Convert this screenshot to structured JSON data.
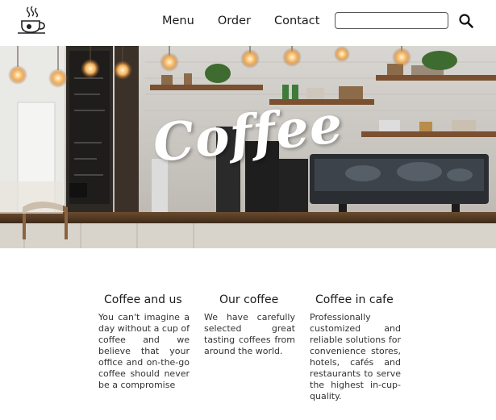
{
  "header": {
    "logo_icon": "coffee-cup-icon",
    "nav": [
      {
        "label": "Menu"
      },
      {
        "label": "Order"
      },
      {
        "label": "Contact"
      }
    ],
    "search": {
      "value": "",
      "placeholder": ""
    },
    "search_icon": "magnifier-icon"
  },
  "hero": {
    "title": "Coffee"
  },
  "features": [
    {
      "title": "Coffee and us",
      "text": "You can't imagine a day without a cup of coffee and we believe that your office and on-the-go coffee should never be a compromise"
    },
    {
      "title": "Our coffee",
      "text": "We have carefully selected great tasting coffees from around the world."
    },
    {
      "title": "Coffee in cafe",
      "text": "Professionally customized and reliable solutions for convenience stores, hotels, cafés and restaurants to serve the highest in-cup-quality."
    }
  ]
}
